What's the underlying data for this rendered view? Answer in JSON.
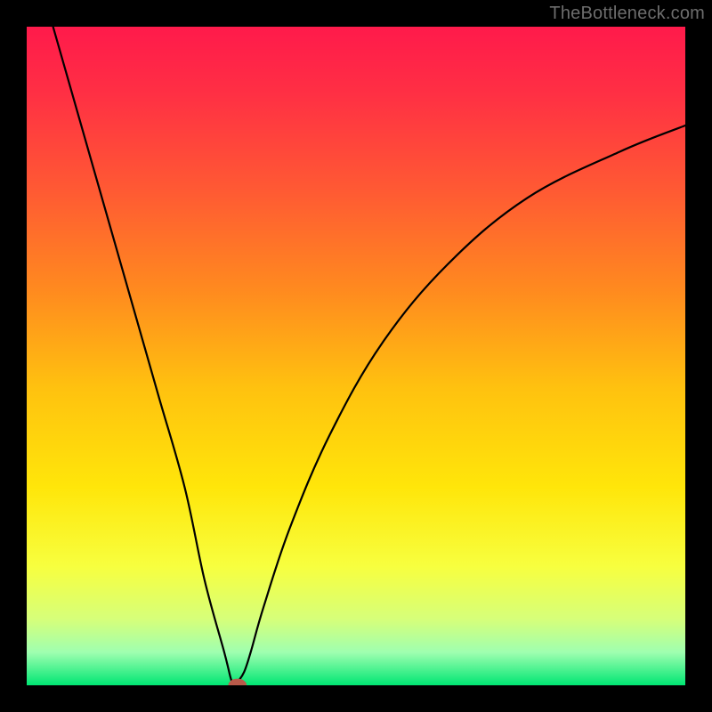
{
  "watermark": "TheBottleneck.com",
  "colors": {
    "frame": "#000000",
    "gradient_stops": [
      {
        "offset": 0.0,
        "color": "#ff1a4b"
      },
      {
        "offset": 0.1,
        "color": "#ff2f44"
      },
      {
        "offset": 0.25,
        "color": "#ff5a33"
      },
      {
        "offset": 0.4,
        "color": "#ff8a1f"
      },
      {
        "offset": 0.55,
        "color": "#ffc20f"
      },
      {
        "offset": 0.7,
        "color": "#ffe60a"
      },
      {
        "offset": 0.82,
        "color": "#f7ff3f"
      },
      {
        "offset": 0.9,
        "color": "#d6ff7a"
      },
      {
        "offset": 0.95,
        "color": "#9fffb0"
      },
      {
        "offset": 1.0,
        "color": "#00e673"
      }
    ],
    "curve": "#000000",
    "marker": "#b85a4a"
  },
  "chart_data": {
    "type": "line",
    "title": "",
    "xlabel": "",
    "ylabel": "",
    "xlim": [
      0,
      100
    ],
    "ylim": [
      0,
      100
    ],
    "grid": false,
    "legend": false,
    "series": [
      {
        "name": "bottleneck-curve",
        "x": [
          4,
          8,
          12,
          16,
          20,
          24,
          27,
          30,
          31,
          31.5,
          32,
          33,
          34,
          36,
          40,
          46,
          54,
          64,
          76,
          90,
          100
        ],
        "y": [
          100,
          86,
          72,
          58,
          44,
          30,
          16,
          5,
          1,
          0,
          0.5,
          2,
          5,
          12,
          24,
          38,
          52,
          64,
          74,
          81,
          85
        ]
      }
    ],
    "marker": {
      "x": 32,
      "y": 0,
      "rx": 1.4,
      "ry": 1.0
    },
    "annotations": []
  }
}
